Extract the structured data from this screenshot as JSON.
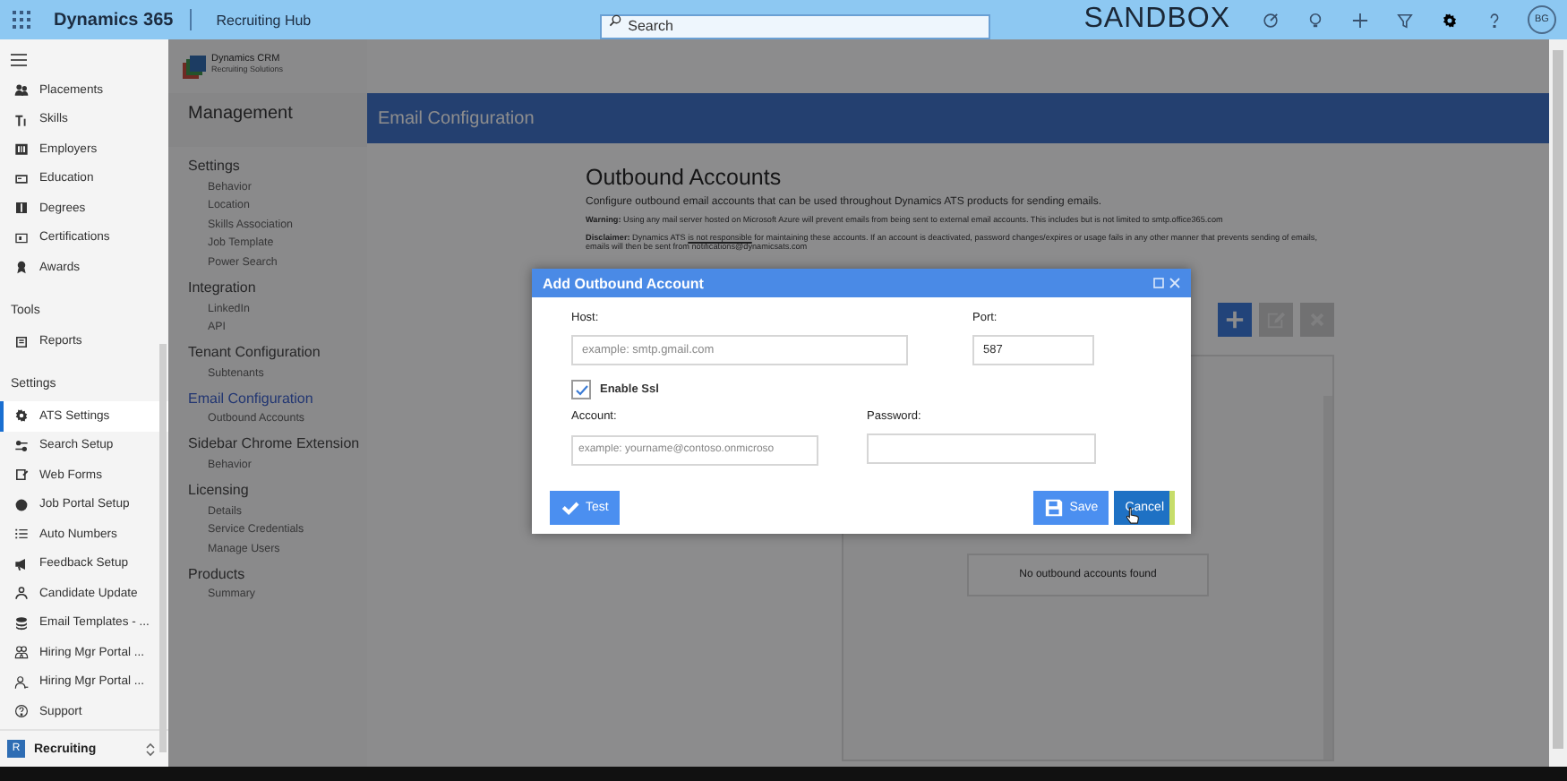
{
  "top_bar": {
    "app_name": "Dynamics 365",
    "area": "Recruiting Hub",
    "search": {
      "placeholder": "Search"
    },
    "environment": "SANDBOX",
    "avatar": "BG"
  },
  "nav": {
    "sections": [
      {
        "items": [
          {
            "label": "Placements",
            "selected": false
          },
          {
            "label": "Skills",
            "selected": false
          },
          {
            "label": "Employers",
            "selected": false
          },
          {
            "label": "Education",
            "selected": false
          },
          {
            "label": "Degrees",
            "selected": false
          },
          {
            "label": "Certifications",
            "selected": false
          },
          {
            "label": "Awards",
            "selected": false
          }
        ]
      },
      {
        "title": "Tools",
        "items": [
          {
            "label": "Reports",
            "selected": false
          }
        ]
      },
      {
        "title": "Settings",
        "items": [
          {
            "label": "ATS Settings",
            "selected": true
          },
          {
            "label": "Search Setup",
            "selected": false
          },
          {
            "label": "Web Forms",
            "selected": false
          },
          {
            "label": "Job Portal Setup",
            "selected": false
          },
          {
            "label": "Auto Numbers",
            "selected": false
          },
          {
            "label": "Feedback Setup",
            "selected": false
          },
          {
            "label": "Candidate Update",
            "selected": false
          },
          {
            "label": "Email Templates - ...",
            "selected": false
          },
          {
            "label": "Hiring Mgr Portal ...",
            "selected": false
          },
          {
            "label": "Hiring Mgr Portal ...",
            "selected": false
          },
          {
            "label": "Support",
            "selected": false
          }
        ]
      }
    ],
    "area_switcher": {
      "badge": "R",
      "label": "Recruiting"
    }
  },
  "logo": {
    "name": "Dynamics CRM",
    "tagline": "Recruiting Solutions"
  },
  "management": {
    "title": "Management",
    "groups": [
      {
        "title": "Settings",
        "selected": false,
        "items": [
          "Behavior",
          "Location",
          "Skills Association",
          "Job Template",
          "Power Search"
        ]
      },
      {
        "title": "Integration",
        "selected": false,
        "items": [
          "LinkedIn",
          "API"
        ]
      },
      {
        "title": "Tenant Configuration",
        "selected": false,
        "items": [
          "Subtenants"
        ]
      },
      {
        "title": "Email Configuration",
        "selected": true,
        "items": [
          "Outbound Accounts"
        ]
      },
      {
        "title": "Sidebar Chrome Extension",
        "selected": false,
        "items": [
          "Behavior"
        ]
      },
      {
        "title": "Licensing",
        "selected": false,
        "items": [
          "Details",
          "Service Credentials",
          "Manage Users"
        ]
      },
      {
        "title": "Products",
        "selected": false,
        "items": [
          "Summary"
        ]
      }
    ]
  },
  "page": {
    "header": "Email Configuration",
    "heading": "Outbound Accounts",
    "intro": "Configure outbound email accounts that can be used throughout Dynamics ATS products for sending emails.",
    "warning": "**Warning:** Using any mail server hosted on Microsoft Azure will prevent emails from being sent to external email accounts. This includes but is not limited to smtp.office365.com",
    "disclaimer": {
      "before": "**Disclaimer:** Dynamics ATS ",
      "link": "is not responsible",
      "after": " for maintaining these accounts. If an account is deactivated, password changes/expires or usage fails in any other manner that prevents sending of emails, emails will then be sent from notifications@dynamicsats.com"
    },
    "toolbar": [
      {
        "kind": "add",
        "disabled": false
      },
      {
        "kind": "edit",
        "disabled": true
      },
      {
        "kind": "delete",
        "disabled": true
      }
    ],
    "empty_message": "No outbound accounts found"
  },
  "dialog": {
    "title": "Add Outbound Account",
    "host": {
      "label": "Host:",
      "placeholder": "example: smtp.gmail.com"
    },
    "port": {
      "label": "Port:",
      "value": "587"
    },
    "ssl": {
      "label": "Enable Ssl",
      "checked": true
    },
    "account": {
      "label": "Account:",
      "placeholder": "example: yourname@contoso.onmicroso"
    },
    "password": {
      "label": "Password:"
    },
    "buttons": [
      {
        "kind": "test",
        "label": "Test",
        "hovered": false
      },
      {
        "kind": "save",
        "label": "Save",
        "hovered": false
      },
      {
        "kind": "cancel",
        "label": "Cancel",
        "hovered": true
      }
    ]
  }
}
